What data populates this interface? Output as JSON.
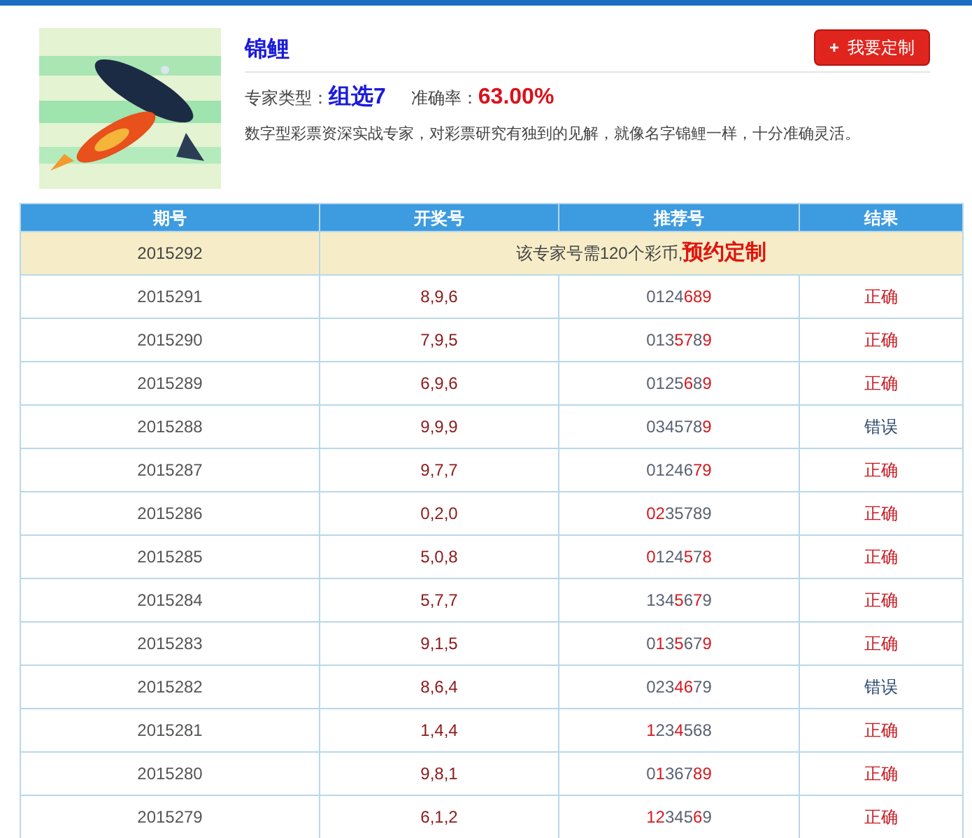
{
  "expert": {
    "name": "锦鲤",
    "type_label": "专家类型：",
    "type_value": "组选7",
    "accuracy_label": "准确率：",
    "accuracy_value": "63.00%",
    "description": "数字型彩票资深实战专家，对彩票研究有独到的见解，就像名字锦鲤一样，十分准确灵活。"
  },
  "custom_button": {
    "icon": "+",
    "label": "我要定制"
  },
  "table": {
    "columns": [
      "期号",
      "开奖号",
      "推荐号",
      "结果"
    ],
    "pending_row": {
      "issue": "2015292",
      "notice": "该专家号需120个彩币,",
      "link": "预约定制"
    },
    "rows": [
      {
        "issue": "2015291",
        "draw": "8,9,6",
        "recommended": [
          {
            "text": "0124",
            "hit": false
          },
          {
            "text": "689",
            "hit": true
          }
        ],
        "result": "正确",
        "correct": true
      },
      {
        "issue": "2015290",
        "draw": "7,9,5",
        "recommended": [
          {
            "text": "013",
            "hit": false
          },
          {
            "text": "57",
            "hit": true
          },
          {
            "text": "8",
            "hit": false
          },
          {
            "text": "9",
            "hit": true
          }
        ],
        "result": "正确",
        "correct": true
      },
      {
        "issue": "2015289",
        "draw": "6,9,6",
        "recommended": [
          {
            "text": "0125",
            "hit": false
          },
          {
            "text": "6",
            "hit": true
          },
          {
            "text": "8",
            "hit": false
          },
          {
            "text": "9",
            "hit": true
          }
        ],
        "result": "正确",
        "correct": true
      },
      {
        "issue": "2015288",
        "draw": "9,9,9",
        "recommended": [
          {
            "text": "034578",
            "hit": false
          },
          {
            "text": "9",
            "hit": true
          }
        ],
        "result": "错误",
        "correct": false
      },
      {
        "issue": "2015287",
        "draw": "9,7,7",
        "recommended": [
          {
            "text": "01246",
            "hit": false
          },
          {
            "text": "79",
            "hit": true
          }
        ],
        "result": "正确",
        "correct": true
      },
      {
        "issue": "2015286",
        "draw": "0,2,0",
        "recommended": [
          {
            "text": "02",
            "hit": true
          },
          {
            "text": "35789",
            "hit": false
          }
        ],
        "result": "正确",
        "correct": true
      },
      {
        "issue": "2015285",
        "draw": "5,0,8",
        "recommended": [
          {
            "text": "0",
            "hit": true
          },
          {
            "text": "124",
            "hit": false
          },
          {
            "text": "5",
            "hit": true
          },
          {
            "text": "7",
            "hit": false
          },
          {
            "text": "8",
            "hit": true
          }
        ],
        "result": "正确",
        "correct": true
      },
      {
        "issue": "2015284",
        "draw": "5,7,7",
        "recommended": [
          {
            "text": "134",
            "hit": false
          },
          {
            "text": "5",
            "hit": true
          },
          {
            "text": "6",
            "hit": false
          },
          {
            "text": "7",
            "hit": true
          },
          {
            "text": "9",
            "hit": false
          }
        ],
        "result": "正确",
        "correct": true
      },
      {
        "issue": "2015283",
        "draw": "9,1,5",
        "recommended": [
          {
            "text": "0",
            "hit": false
          },
          {
            "text": "1",
            "hit": true
          },
          {
            "text": "3",
            "hit": false
          },
          {
            "text": "5",
            "hit": true
          },
          {
            "text": "67",
            "hit": false
          },
          {
            "text": "9",
            "hit": true
          }
        ],
        "result": "正确",
        "correct": true
      },
      {
        "issue": "2015282",
        "draw": "8,6,4",
        "recommended": [
          {
            "text": "023",
            "hit": false
          },
          {
            "text": "46",
            "hit": true
          },
          {
            "text": "79",
            "hit": false
          }
        ],
        "result": "错误",
        "correct": false
      },
      {
        "issue": "2015281",
        "draw": "1,4,4",
        "recommended": [
          {
            "text": "1",
            "hit": true
          },
          {
            "text": "23",
            "hit": false
          },
          {
            "text": "4",
            "hit": true
          },
          {
            "text": "568",
            "hit": false
          }
        ],
        "result": "正确",
        "correct": true
      },
      {
        "issue": "2015280",
        "draw": "9,8,1",
        "recommended": [
          {
            "text": "0",
            "hit": false
          },
          {
            "text": "1",
            "hit": true
          },
          {
            "text": "367",
            "hit": false
          },
          {
            "text": "89",
            "hit": true
          }
        ],
        "result": "正确",
        "correct": true
      },
      {
        "issue": "2015279",
        "draw": "6,1,2",
        "recommended": [
          {
            "text": "12",
            "hit": true
          },
          {
            "text": "345",
            "hit": false
          },
          {
            "text": "6",
            "hit": true
          },
          {
            "text": "9",
            "hit": false
          }
        ],
        "result": "正确",
        "correct": true
      }
    ]
  }
}
